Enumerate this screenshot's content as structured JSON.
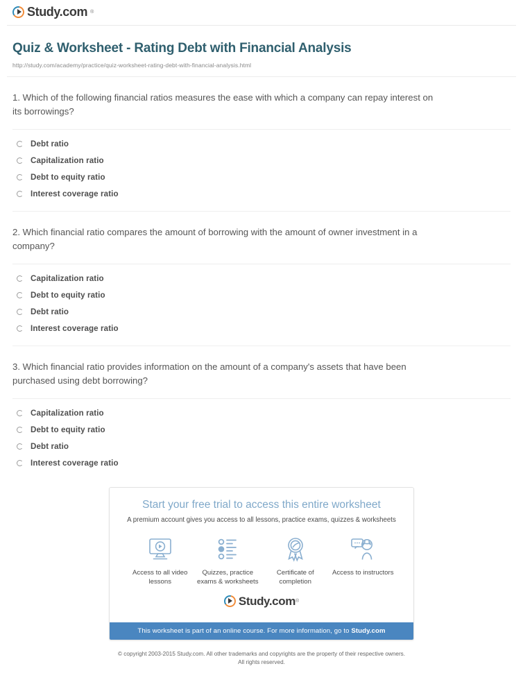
{
  "brand": {
    "name": "Study.com",
    "trademark": "®",
    "logo_icon": "play-circle-icon"
  },
  "header": {
    "title": "Quiz & Worksheet - Rating Debt with Financial Analysis",
    "url": "http://study.com/academy/practice/quiz-worksheet-rating-debt-with-financial-analysis.html"
  },
  "questions": [
    {
      "text": "1. Which of the following financial ratios measures the ease with which a company can repay interest on its borrowings?",
      "options": [
        "Debt ratio",
        "Capitalization ratio",
        "Debt to equity ratio",
        "Interest coverage ratio"
      ]
    },
    {
      "text": "2. Which financial ratio compares the amount of borrowing with the amount of owner investment in a company?",
      "options": [
        "Capitalization ratio",
        "Debt to equity ratio",
        "Debt ratio",
        "Interest coverage ratio"
      ]
    },
    {
      "text": "3. Which financial ratio provides information on the amount of a company's assets that have been purchased using debt borrowing?",
      "options": [
        "Capitalization ratio",
        "Debt to equity ratio",
        "Debt ratio",
        "Interest coverage ratio"
      ]
    }
  ],
  "promo": {
    "title": "Start your free trial to access this entire worksheet",
    "subtitle": "A premium account gives you access to all lessons, practice exams, quizzes & worksheets",
    "features": [
      {
        "icon": "monitor-play-icon",
        "label": "Access to all video lessons"
      },
      {
        "icon": "checklist-icon",
        "label": "Quizzes, practice exams & worksheets"
      },
      {
        "icon": "award-ribbon-icon",
        "label": "Certificate of completion"
      },
      {
        "icon": "instructor-chat-icon",
        "label": "Access to instructors"
      }
    ],
    "banner_text": "This worksheet is part of an online course. For more information, go to ",
    "banner_link": "Study.com"
  },
  "footer": {
    "line1": "© copyright 2003-2015 Study.com. All other trademarks and copyrights are the property of their respective owners.",
    "line2": "All rights reserved."
  },
  "colors": {
    "title": "#2f5f6e",
    "promo_title": "#7fa8c9",
    "banner": "#4a86c0",
    "icon_line": "#8aafd0"
  }
}
